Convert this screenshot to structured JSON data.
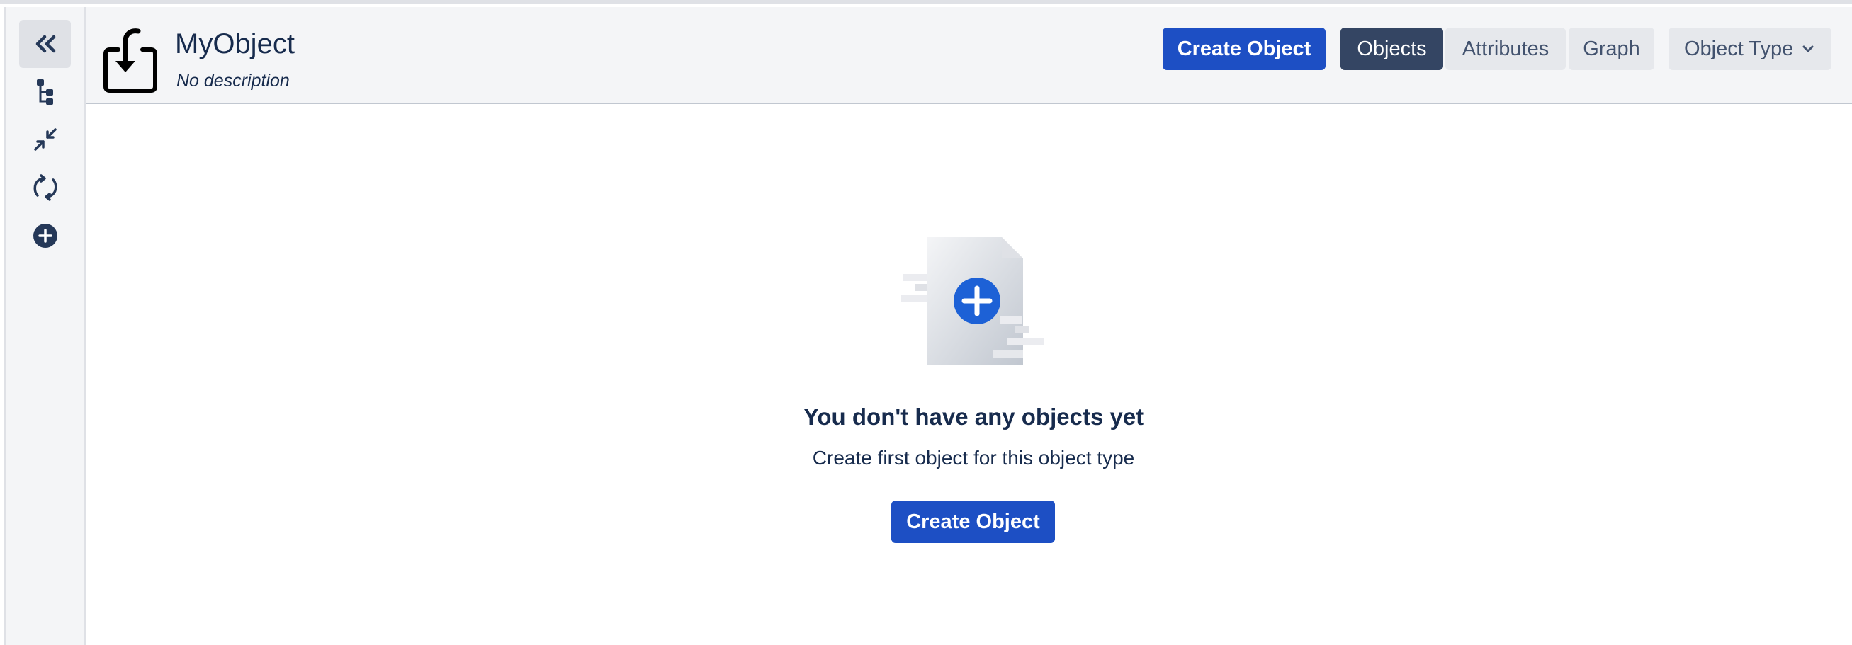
{
  "sidebar": {
    "items": [
      {
        "icon": "chevrons-left-icon",
        "active": true
      },
      {
        "icon": "hierarchy-tree-icon"
      },
      {
        "icon": "collapse-arrows-icon"
      },
      {
        "icon": "refresh-icon"
      },
      {
        "icon": "add-circle-icon"
      }
    ]
  },
  "header": {
    "icon": "download-arrow-icon",
    "title": "MyObject",
    "subtitle": "No description",
    "create_button": "Create Object",
    "tabs": [
      {
        "label": "Objects",
        "selected": true
      },
      {
        "label": "Attributes",
        "selected": false
      },
      {
        "label": "Graph",
        "selected": false
      }
    ],
    "dropdown_label": "Object Type"
  },
  "empty_state": {
    "illustration": "document-add-icon",
    "title": "You don't have any objects yet",
    "description": "Create first object for this object type",
    "button": "Create Object"
  },
  "colors": {
    "primary": "#1d4fc4",
    "tab_selected": "#344563",
    "tab_default": "#e6e8ec",
    "header_bg": "#f4f5f7",
    "text": "#172b4d"
  }
}
